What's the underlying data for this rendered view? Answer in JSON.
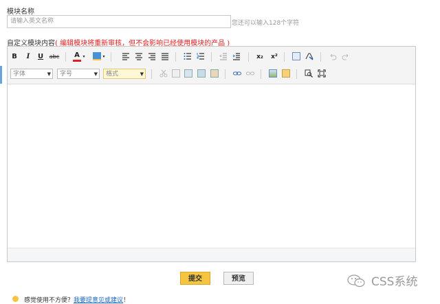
{
  "form": {
    "module_name_label": "模块名称",
    "module_name_placeholder": "请输入英文名称",
    "module_name_hint": "您还可以输入128个字符",
    "content_label": "自定义模块内容",
    "content_warning": "( 编辑模块将重新审核，但不会影响已经使用模块的产品 )"
  },
  "toolbar": {
    "bold": "B",
    "italic": "I",
    "underline": "U",
    "strike": "abc",
    "font_color": "A",
    "subscript": "x₂",
    "superscript": "x²",
    "font_family_value": "字体",
    "font_size_value": "字号",
    "format_value": "格式"
  },
  "buttons": {
    "submit": "提交",
    "preview": "预览"
  },
  "footer": {
    "feedback_text": "感觉使用不方便？",
    "feedback_link": "我要提意见或建议",
    "feedback_suffix": "！"
  },
  "watermark": {
    "text": "CSS系统"
  },
  "colors": {
    "warning": "#e02020",
    "submit_bg": "#f5c542",
    "link": "#1a66c2"
  }
}
